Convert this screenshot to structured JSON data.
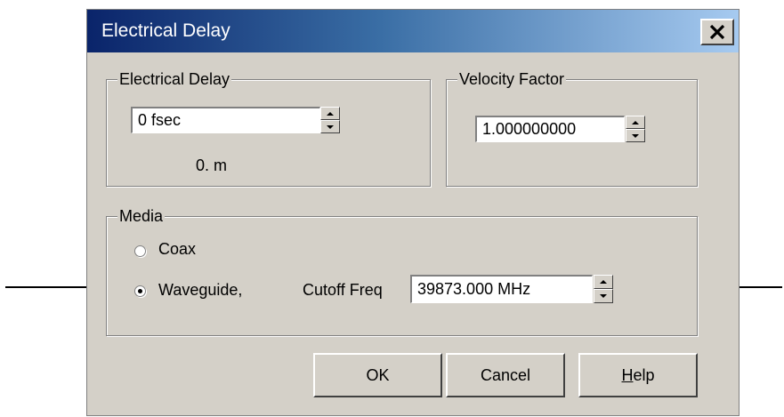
{
  "dialog": {
    "title": "Electrical Delay",
    "close_glyph": "✕"
  },
  "electrical_delay": {
    "group_label": "Electrical Delay",
    "value": "0 fsec",
    "distance": "0. m"
  },
  "velocity_factor": {
    "group_label": "Velocity Factor",
    "value": "1.000000000"
  },
  "media": {
    "group_label": "Media",
    "options": [
      {
        "label": "Coax",
        "selected": false
      },
      {
        "label": "Waveguide,",
        "selected": true
      }
    ],
    "cutoff_label": "Cutoff Freq",
    "cutoff_value": "39873.000 MHz"
  },
  "buttons": {
    "ok": "OK",
    "cancel": "Cancel",
    "help_mnemonic": "H",
    "help_rest": "elp"
  },
  "icons": {
    "close": "close-icon",
    "spin_up": "spin-up-icon",
    "spin_down": "spin-down-icon",
    "arrow_right": "arrow-right-icon",
    "arrow_left": "arrow-left-icon"
  },
  "colors": {
    "titlebar_start": "#0a246a",
    "titlebar_end": "#a6caf0",
    "dialog_bg": "#d4d0c8"
  }
}
